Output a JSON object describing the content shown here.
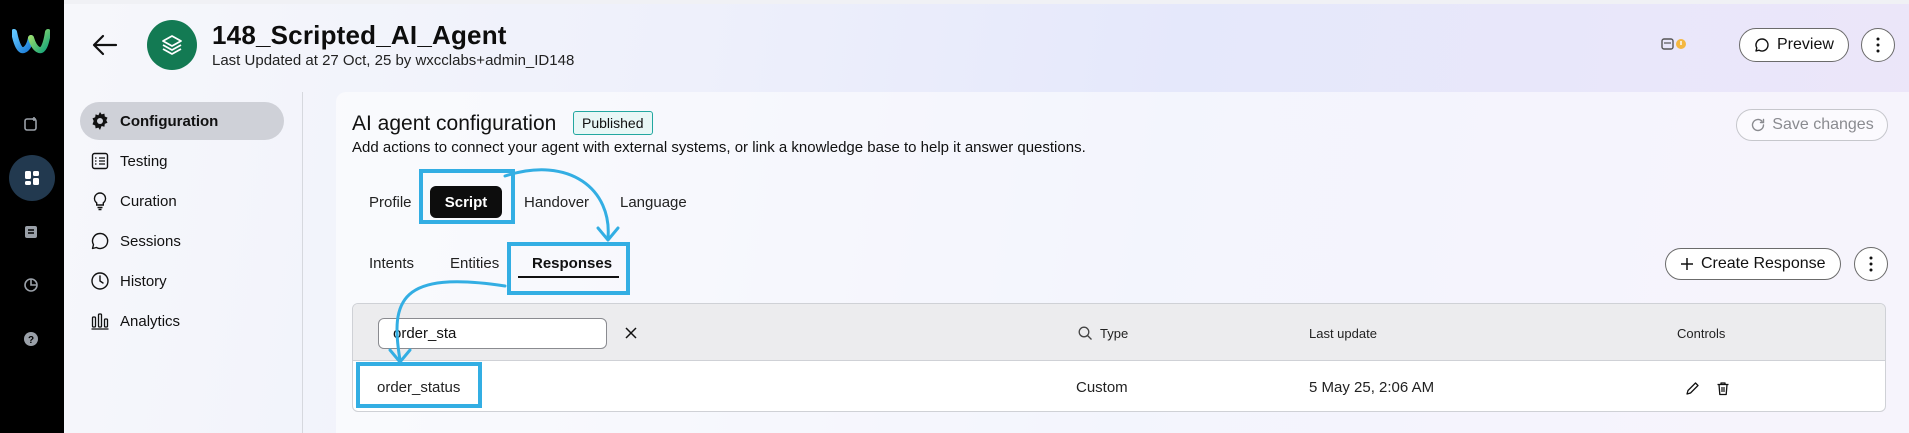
{
  "header": {
    "title": "148_Scripted_AI_Agent",
    "subtitle": "Last Updated at 27 Oct, 25 by wxcclabs+admin_ID148",
    "preview_label": "Preview"
  },
  "sidebar": {
    "items": [
      {
        "label": "Configuration",
        "icon": "gear-icon",
        "active": true
      },
      {
        "label": "Testing",
        "icon": "checklist-icon",
        "active": false
      },
      {
        "label": "Curation",
        "icon": "lightbulb-icon",
        "active": false
      },
      {
        "label": "Sessions",
        "icon": "chat-icon",
        "active": false
      },
      {
        "label": "History",
        "icon": "clock-icon",
        "active": false
      },
      {
        "label": "Analytics",
        "icon": "bar-chart-icon",
        "active": false
      }
    ]
  },
  "config": {
    "title": "AI agent configuration",
    "status": "Published",
    "description": "Add actions to connect your agent with external systems, or link a knowledge base to help it answer questions.",
    "save_label": "Save changes"
  },
  "tabs": [
    {
      "label": "Profile",
      "active": false
    },
    {
      "label": "Script",
      "active": true
    },
    {
      "label": "Handover",
      "active": false
    },
    {
      "label": "Language",
      "active": false
    }
  ],
  "subtabs": [
    {
      "label": "Intents",
      "active": false
    },
    {
      "label": "Entities",
      "active": false
    },
    {
      "label": "Responses",
      "active": true
    }
  ],
  "create_response_label": "Create Response",
  "table": {
    "search_value": "order_sta",
    "columns": [
      "Type",
      "Last update",
      "Controls"
    ],
    "rows": [
      {
        "name": "order_status",
        "type": "Custom",
        "last_update": "5 May 25, 2:06 AM"
      }
    ]
  },
  "colors": {
    "accent_highlight": "#33aee3",
    "agent_avatar": "#137a53",
    "published_border": "#22a7a0"
  }
}
